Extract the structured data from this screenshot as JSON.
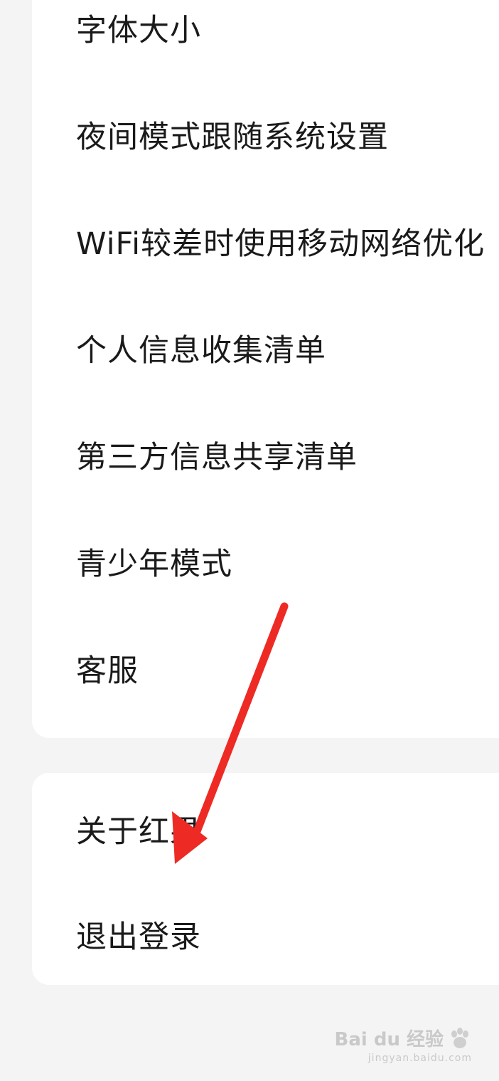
{
  "settings_group_1": {
    "items": [
      {
        "label": "字体大小"
      },
      {
        "label": "夜间模式跟随系统设置"
      },
      {
        "label": "WiFi较差时使用移动网络优化"
      },
      {
        "label": "个人信息收集清单"
      },
      {
        "label": "第三方信息共享清单"
      },
      {
        "label": "青少年模式"
      },
      {
        "label": "客服"
      }
    ]
  },
  "settings_group_2": {
    "items": [
      {
        "label": "关于红果"
      },
      {
        "label": "退出登录"
      }
    ]
  },
  "annotation": {
    "arrow_color": "#ee2a24",
    "points_to": "退出登录"
  },
  "watermark": {
    "brand": "Bai du 经验",
    "url": "jingyan.baidu.com"
  }
}
